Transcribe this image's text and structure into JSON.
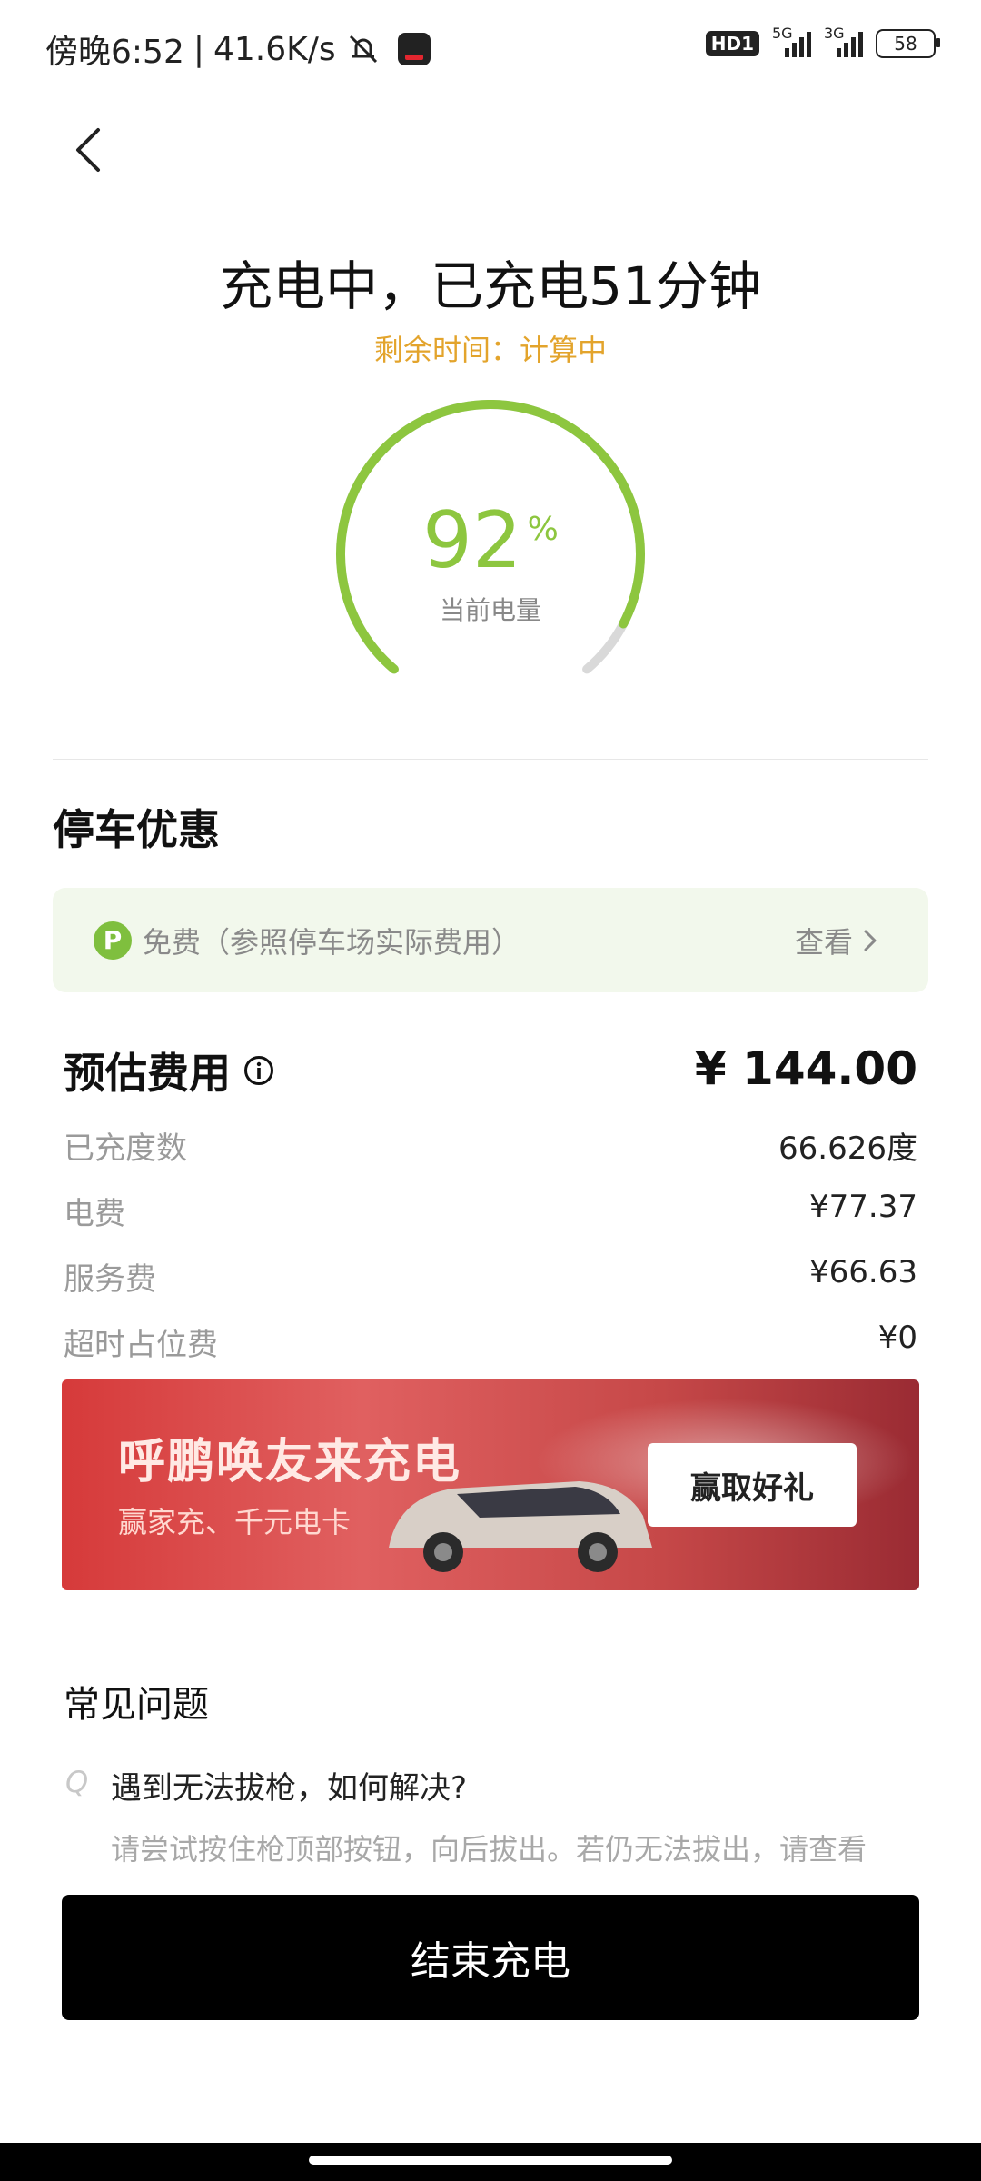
{
  "status_bar": {
    "time": "傍晚6:52",
    "speed": "41.6K/s",
    "hd_badge": "HD1",
    "net1": "5G",
    "net2": "3G",
    "battery": "58"
  },
  "header": {
    "title": "充电中，已充电51分钟",
    "remaining_time": "剩余时间：计算中"
  },
  "gauge": {
    "value": "92",
    "unit": "%",
    "label": "当前电量",
    "fraction": 0.92,
    "accent_color": "#8dc63f"
  },
  "parking": {
    "section_title": "停车优惠",
    "icon_letter": "P",
    "text": "免费（参照停车场实际费用）",
    "view_label": "查看"
  },
  "fees": {
    "title": "预估费用",
    "total": "¥ 144.00",
    "rows": [
      {
        "label": "已充度数",
        "value": "66.626度"
      },
      {
        "label": "电费",
        "value": "¥77.37"
      },
      {
        "label": "服务费",
        "value": "¥66.63"
      },
      {
        "label": "超时占位费",
        "value": "¥0"
      }
    ]
  },
  "banner": {
    "title": "呼鹏唤友来充电",
    "subtitle": "赢家充、千元电卡",
    "button": "赢取好礼"
  },
  "faq": {
    "title": "常见问题",
    "q_icon": "Q",
    "question": "遇到无法拔枪，如何解决?",
    "answer": "请尝试按住枪顶部按钮，向后拔出。若仍无法拔出，请查看"
  },
  "action": {
    "end_label": "结束充电"
  }
}
